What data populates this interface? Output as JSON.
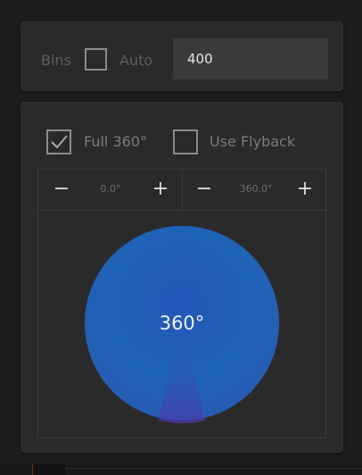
{
  "bins": {
    "label": "Bins",
    "auto_label": "Auto",
    "auto_checked": false,
    "value": "400"
  },
  "angle": {
    "full360_label": "Full 360°",
    "full360_checked": true,
    "flyback_label": "Use Flyback",
    "flyback_checked": false,
    "start": {
      "minus": "−",
      "value": "0.0°",
      "plus": "+"
    },
    "end": {
      "minus": "−",
      "value": "360.0°",
      "plus": "+"
    },
    "dial_label": "360°",
    "dial_sweep_fraction": 1.0
  },
  "colors": {
    "accent_blue": "#1f5fb4",
    "accent_purple": "#4a3aa8"
  }
}
